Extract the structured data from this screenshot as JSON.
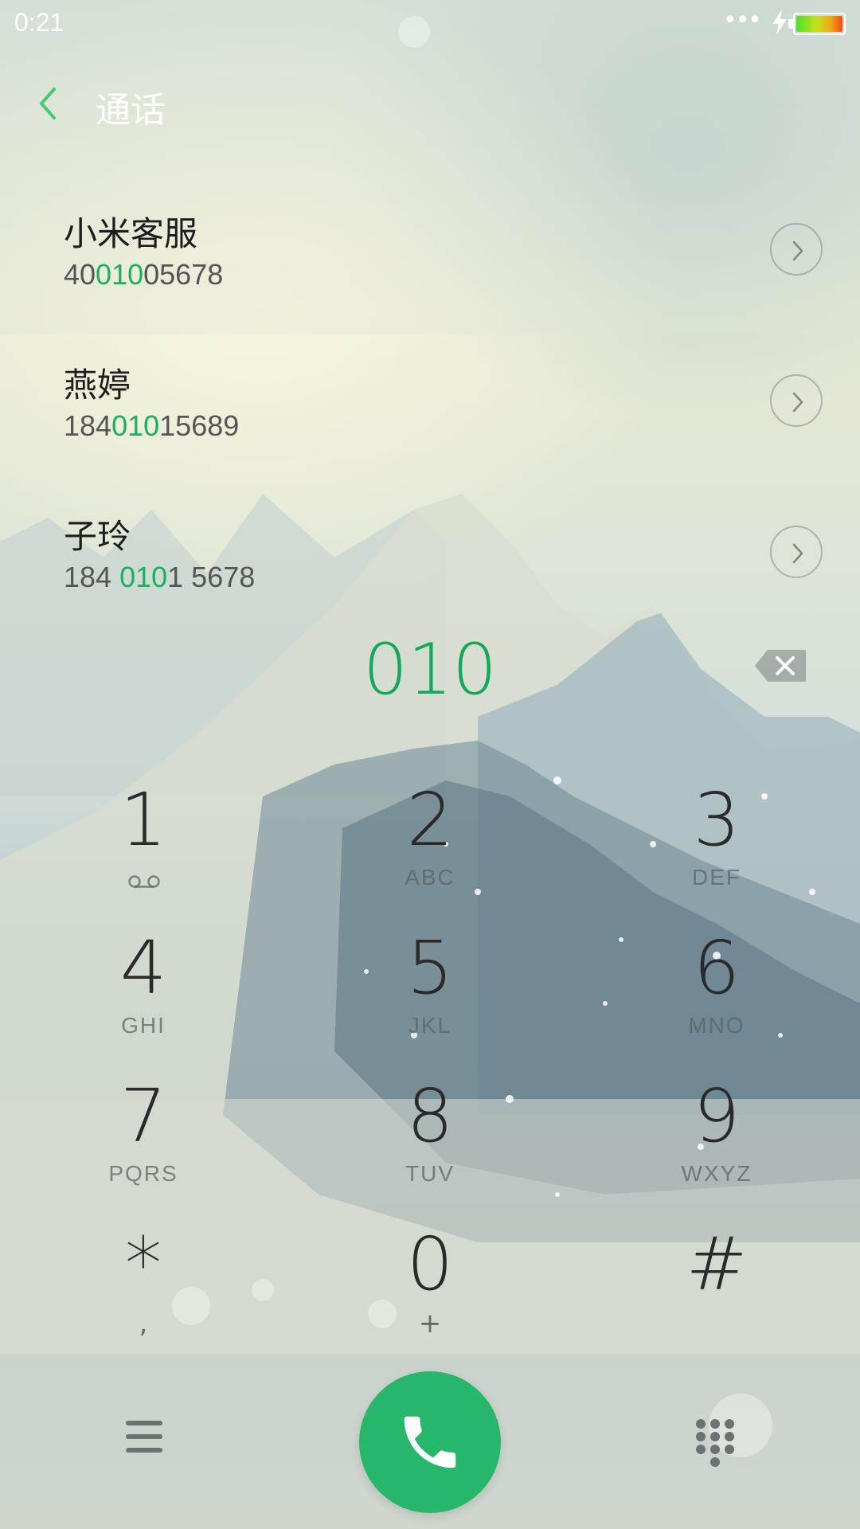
{
  "status_bar": {
    "time": "0:21",
    "signal_dots": "•••",
    "icons": [
      "charging-bolt-icon",
      "battery-icon"
    ]
  },
  "header": {
    "back_icon": "chevron-left-icon",
    "title": "通话"
  },
  "contacts": [
    {
      "name": "小米客服",
      "number_before": "40",
      "number_match": "010",
      "number_after": "05678",
      "detail_icon": "chevron-right-circle-icon"
    },
    {
      "name": "燕婷",
      "number_before": "184",
      "number_match": "010",
      "number_after": "15689",
      "detail_icon": "chevron-right-circle-icon"
    },
    {
      "name": "子玲",
      "number_before": "184 ",
      "number_match": "010",
      "number_after": "1 5678",
      "detail_icon": "chevron-right-circle-icon"
    }
  ],
  "dialed": {
    "digits": "010",
    "backspace_icon": "backspace-icon"
  },
  "keypad": {
    "keys": [
      {
        "digit": "1",
        "sub": "",
        "sub_icon": "voicemail-icon"
      },
      {
        "digit": "2",
        "sub": "ABC"
      },
      {
        "digit": "3",
        "sub": "DEF"
      },
      {
        "digit": "4",
        "sub": "GHI"
      },
      {
        "digit": "5",
        "sub": "JKL"
      },
      {
        "digit": "6",
        "sub": "MNO"
      },
      {
        "digit": "7",
        "sub": "PQRS"
      },
      {
        "digit": "8",
        "sub": "TUV"
      },
      {
        "digit": "9",
        "sub": "WXYZ"
      },
      {
        "digit": "*",
        "sub": ","
      },
      {
        "digit": "0",
        "sub": "+"
      },
      {
        "digit": "#",
        "sub": ""
      }
    ]
  },
  "bottom_bar": {
    "menu_icon": "menu-icon",
    "call_icon": "phone-icon",
    "dialpad_icon": "dialpad-icon"
  },
  "colors": {
    "accent_green": "#1bb061",
    "call_button": "#27b76a"
  }
}
